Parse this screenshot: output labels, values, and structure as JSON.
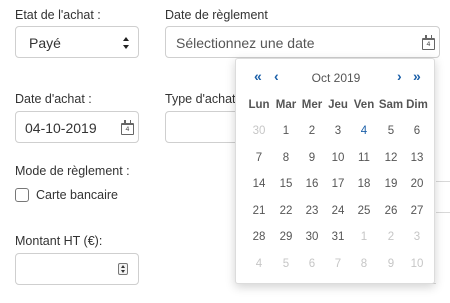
{
  "form": {
    "etat_label": "Etat de l'achat :",
    "etat_value": "Payé",
    "date_reglement_label": "Date de règlement",
    "date_reglement_placeholder": "Sélectionnez une date",
    "date_achat_label": "Date d'achat :",
    "date_achat_value": "04-10-2019",
    "type_achat_label": "Type d'achat",
    "mode_reglement_label": "Mode de règlement :",
    "carte_label": "Carte bancaire",
    "montant_label": "Montant HT (€):",
    "montant_value": ""
  },
  "icons": {
    "calendar_glyph_text": "4"
  },
  "datepicker": {
    "prev_year": "«",
    "prev_month": "‹",
    "month_label": "Oct 2019",
    "next_month": "›",
    "next_year": "»",
    "weekdays": [
      "Lun",
      "Mar",
      "Mer",
      "Jeu",
      "Ven",
      "Sam",
      "Dim"
    ],
    "weeks": [
      [
        "30",
        "1",
        "2",
        "3",
        "4",
        "5",
        "6"
      ],
      [
        "7",
        "8",
        "9",
        "10",
        "11",
        "12",
        "13"
      ],
      [
        "14",
        "15",
        "16",
        "17",
        "18",
        "19",
        "20"
      ],
      [
        "21",
        "22",
        "23",
        "24",
        "25",
        "26",
        "27"
      ],
      [
        "28",
        "29",
        "30",
        "31",
        "1",
        "2",
        "3"
      ],
      [
        "4",
        "5",
        "6",
        "7",
        "8",
        "9",
        "10"
      ]
    ],
    "today": "4"
  },
  "colors": {
    "accent": "#1a5fa8",
    "muted_day": "#c6c6c6"
  }
}
